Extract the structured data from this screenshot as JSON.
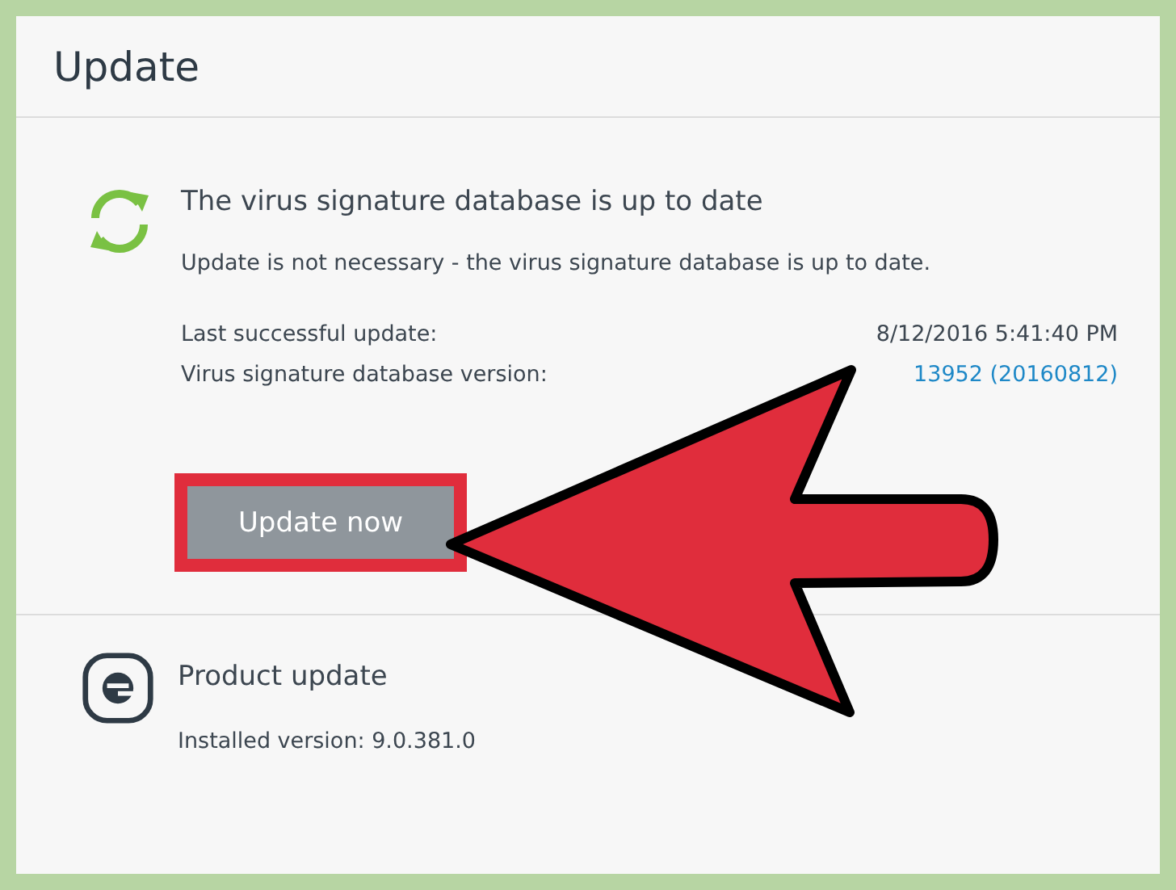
{
  "header": {
    "title": "Update"
  },
  "signature_update": {
    "title": "The virus signature database is up to date",
    "message": "Update is not necessary - the virus signature database is up to date.",
    "details": [
      {
        "label": "Last successful update:",
        "value": "8/12/2016 5:41:40 PM",
        "kind": "text"
      },
      {
        "label": "Virus signature database version:",
        "value": "13952 (20160812)",
        "kind": "link"
      }
    ],
    "button": {
      "label": "Update now",
      "highlighted": true
    }
  },
  "product_update": {
    "title": "Product update",
    "installed": "Installed version: 9.0.381.0"
  }
}
